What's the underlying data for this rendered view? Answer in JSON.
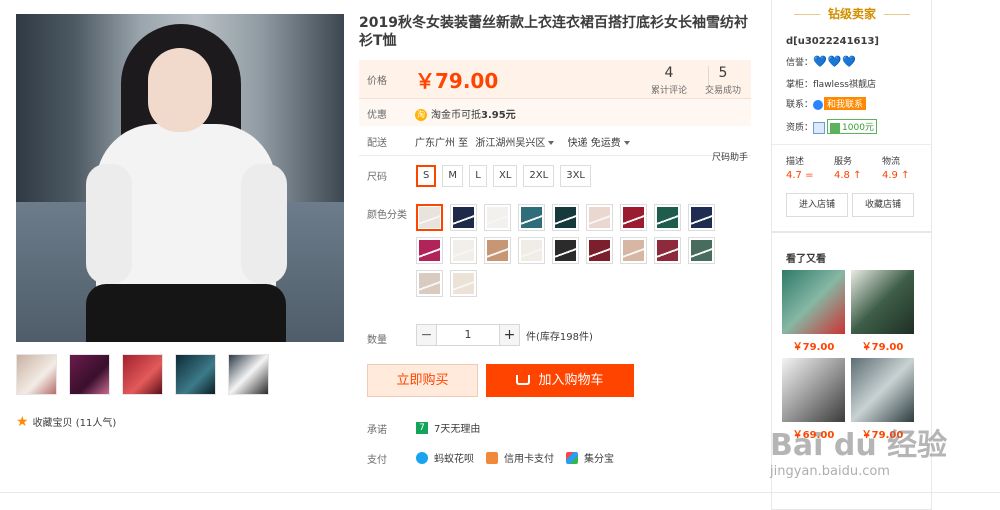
{
  "product": {
    "title": "2019秋冬女装装蕾丝新款上衣连衣裙百搭打底衫女长袖雪纺衬衫T恤",
    "favorite_label": "收藏宝贝 (11人气)"
  },
  "price_box": {
    "price_label": "价格",
    "price": "￥79.00",
    "reviews_count": "4",
    "reviews_label": "累计评论",
    "deals_count": "5",
    "deals_label": "交易成功"
  },
  "promo": {
    "label": "优惠",
    "coin_icon": "淘",
    "text_prefix": "淘金币可抵",
    "text_amount": "3.95元"
  },
  "shipping": {
    "label": "配送",
    "from": "广东广州 至",
    "to": "浙江湖州吴兴区",
    "method": "快递 免运费"
  },
  "size": {
    "label": "尺码",
    "help": "尺码助手",
    "options": [
      "S",
      "M",
      "L",
      "XL",
      "2XL",
      "3XL"
    ],
    "selected": "S"
  },
  "color": {
    "label": "颜色分类",
    "swatches": [
      "#e8e3dc",
      "#1d2a4a",
      "#f3f1ee",
      "#2f6d7a",
      "#163a3c",
      "#ead7d0",
      "#9b1b30",
      "#1e5c4c",
      "#1f2d52",
      "#b2235a",
      "#f2eee9",
      "#c79673",
      "#f0ece6",
      "#2b2b2b",
      "#7a1f2b",
      "#d8b6a4",
      "#8d2a3c",
      "#486d5f",
      "#d9cbbf",
      "#ece2d6"
    ]
  },
  "quantity": {
    "label": "数量",
    "value": "1",
    "minus": "−",
    "plus": "+",
    "stock": "件(库存198件)"
  },
  "actions": {
    "buy_now": "立即购买",
    "add_cart": "加入购物车"
  },
  "pledge": {
    "label": "承诺",
    "icon": "7",
    "text": "7天无理由"
  },
  "payment": {
    "label": "支付",
    "methods": [
      "蚂蚁花呗",
      "信用卡支付",
      "集分宝"
    ]
  },
  "seller": {
    "header": "钻级卖家",
    "id": "d[u3022241613]",
    "credit_label": "信誉：",
    "credit_icons": "💙💙💙",
    "shopkeeper_label": "掌柜：",
    "shopkeeper": "flawless祺靓店",
    "contact_label": "联系：",
    "contact_badge": "和我联系",
    "qualification_label": "资质：",
    "deposit": "1000元",
    "scores": [
      {
        "key": "描述",
        "value": "4.7 ="
      },
      {
        "key": "服务",
        "value": "4.8 ↑"
      },
      {
        "key": "物流",
        "value": "4.9 ↑"
      }
    ],
    "enter_store": "进入店铺",
    "collect_store": "收藏店铺"
  },
  "also_viewed": {
    "title": "看了又看",
    "items": [
      {
        "price": "￥79.00"
      },
      {
        "price": "￥79.00"
      },
      {
        "price": "￥69.00"
      },
      {
        "price": "￥79.00"
      }
    ]
  },
  "watermark": {
    "logo": "Bai du 经验",
    "url": "jingyan.baidu.com"
  }
}
